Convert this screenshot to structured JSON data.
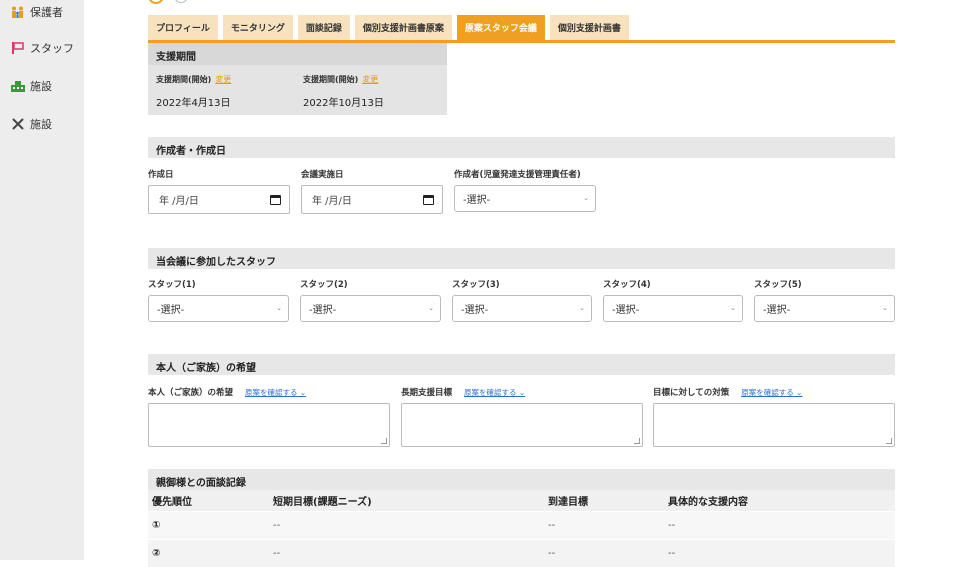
{
  "sidebar": {
    "items": [
      {
        "label": "保護者",
        "icon": "family-icon"
      },
      {
        "label": "スタッフ",
        "icon": "staff-icon"
      },
      {
        "label": "施設",
        "icon": "building-icon"
      },
      {
        "label": "施設",
        "icon": "tools-icon"
      }
    ]
  },
  "tabs": [
    {
      "label": "プロフィール",
      "active": false
    },
    {
      "label": "モニタリング",
      "active": false
    },
    {
      "label": "面談記録",
      "active": false
    },
    {
      "label": "個別支援計画書原案",
      "active": false
    },
    {
      "label": "原案スタッフ会議",
      "active": true
    },
    {
      "label": "個別支援計画書",
      "active": false
    }
  ],
  "period": {
    "title": "支援期間",
    "start_label": "支援期間(開始)",
    "start_change": "変更",
    "start_value": "2022年4月13日",
    "end_label": "支援期間(開始)",
    "end_change": "変更",
    "end_value": "2022年10月13日"
  },
  "creator": {
    "title": "作成者・作成日",
    "created_label": "作成日",
    "created_value": "年 /月/日",
    "meeting_label": "会議実施日",
    "meeting_value": "年 /月/日",
    "author_label": "作成者(児童発達支援管理責任者)",
    "author_value": "-選択-"
  },
  "staff": {
    "title": "当会議に参加したスタッフ",
    "slots": [
      {
        "label": "スタッフ(1)",
        "value": "-選択-"
      },
      {
        "label": "スタッフ(2)",
        "value": "-選択-"
      },
      {
        "label": "スタッフ(3)",
        "value": "-選択-"
      },
      {
        "label": "スタッフ(4)",
        "value": "-選択-"
      },
      {
        "label": "スタッフ(5)",
        "value": "-選択-"
      }
    ]
  },
  "wishes": {
    "title": "本人（ご家族）の希望",
    "fields": [
      {
        "label": "本人（ご家族）の希望",
        "link": "原案を確認する ⌄"
      },
      {
        "label": "長期支援目標",
        "link": "原案を確認する ⌄"
      },
      {
        "label": "目標に対しての対策",
        "link": "原案を確認する ⌄"
      }
    ]
  },
  "records": {
    "title": "親御様との面談記録",
    "columns": [
      "優先順位",
      "短期目標(課題ニーズ)",
      "到達目標",
      "具体的な支援内容"
    ],
    "rows": [
      [
        "①",
        "--",
        "--",
        "--"
      ],
      [
        "②",
        "--",
        "--",
        "--"
      ]
    ]
  },
  "colors": {
    "accent": "#f0a020",
    "link": "#2a6fd6"
  }
}
